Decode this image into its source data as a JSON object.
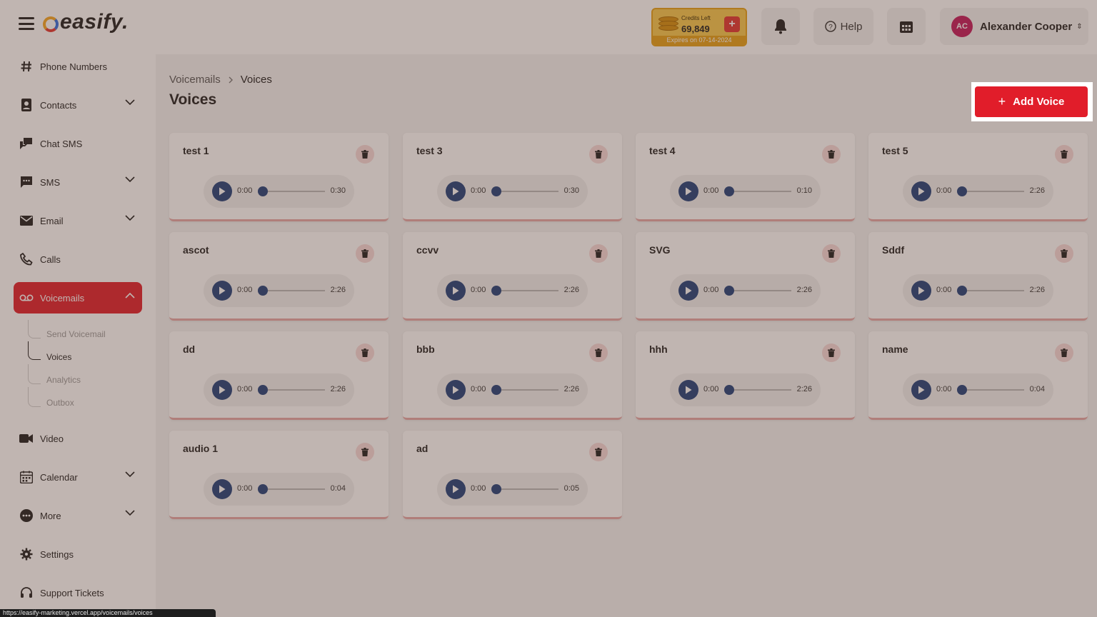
{
  "app": {
    "logo_text": "easify.",
    "credits": {
      "label": "Credits Left",
      "value": "69,849",
      "add": "+",
      "expiry": "Expires on 07-14-2024"
    },
    "help_label": "Help",
    "user": {
      "initials": "AC",
      "name": "Alexander Cooper"
    }
  },
  "sidebar": {
    "items": [
      {
        "label": "Phone Numbers",
        "icon": "hash-icon"
      },
      {
        "label": "Contacts",
        "icon": "contacts-icon",
        "expandable": true
      },
      {
        "label": "Chat SMS",
        "icon": "chat-icon"
      },
      {
        "label": "SMS",
        "icon": "message-icon",
        "expandable": true
      },
      {
        "label": "Email",
        "icon": "mail-icon",
        "expandable": true
      },
      {
        "label": "Calls",
        "icon": "phone-icon"
      },
      {
        "label": "Voicemails",
        "icon": "voicemail-icon",
        "expandable": true,
        "active": true
      },
      {
        "label": "Video",
        "icon": "video-icon"
      },
      {
        "label": "Calendar",
        "icon": "calendar-icon",
        "expandable": true
      },
      {
        "label": "More",
        "icon": "more-icon",
        "expandable": true
      },
      {
        "label": "Settings",
        "icon": "gear-icon"
      },
      {
        "label": "Support Tickets",
        "icon": "headset-icon"
      }
    ],
    "voicemail_subitems": [
      "Send Voicemail",
      "Voices",
      "Analytics",
      "Outbox"
    ]
  },
  "breadcrumb": {
    "parent": "Voicemails",
    "current": "Voices"
  },
  "page_title": "Voices",
  "add_button": {
    "plus": "+",
    "label": "Add Voice"
  },
  "voices": [
    {
      "name": "test 1",
      "current": "0:00",
      "duration": "0:30"
    },
    {
      "name": "test 3",
      "current": "0:00",
      "duration": "0:30"
    },
    {
      "name": "test 4",
      "current": "0:00",
      "duration": "0:10"
    },
    {
      "name": "test 5",
      "current": "0:00",
      "duration": "2:26"
    },
    {
      "name": "ascot",
      "current": "0:00",
      "duration": "2:26"
    },
    {
      "name": "ccvv",
      "current": "0:00",
      "duration": "2:26"
    },
    {
      "name": "SVG",
      "current": "0:00",
      "duration": "2:26"
    },
    {
      "name": "Sddf",
      "current": "0:00",
      "duration": "2:26"
    },
    {
      "name": "dd",
      "current": "0:00",
      "duration": "2:26"
    },
    {
      "name": "bbb",
      "current": "0:00",
      "duration": "2:26"
    },
    {
      "name": "hhh",
      "current": "0:00",
      "duration": "2:26"
    },
    {
      "name": "name",
      "current": "0:00",
      "duration": "0:04"
    },
    {
      "name": "audio 1",
      "current": "0:00",
      "duration": "0:04"
    },
    {
      "name": "ad",
      "current": "0:00",
      "duration": "0:05"
    }
  ],
  "status_url": "https://easify-marketing.vercel.app/voicemails/voices",
  "colors": {
    "accent": "#e11d2a",
    "player": "#1f3f7a",
    "credits": "#f7c84d"
  }
}
